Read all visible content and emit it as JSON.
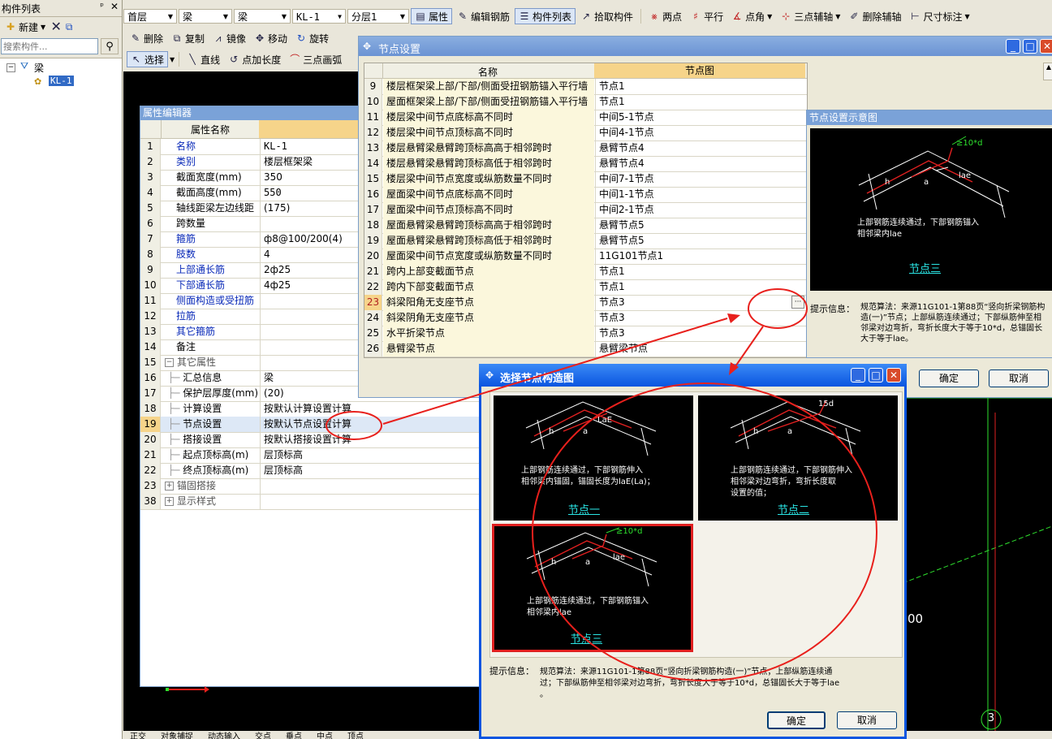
{
  "left_panel": {
    "title": "构件列表",
    "new_label": "新建",
    "search_placeholder": "搜索构件...",
    "tree_root": "梁",
    "tree_child": "KL-1"
  },
  "toolbar1": {
    "floor": "首层",
    "category": "梁",
    "type": "梁",
    "element": "KL-1",
    "layer": "分层1",
    "attr_label": "属性",
    "edit_rebar": "编辑钢筋",
    "component_list": "构件列表",
    "pick_component": "拾取构件",
    "two_points": "两点",
    "parallel": "平行",
    "point_angle": "点角",
    "three_point_axis": "三点辅轴",
    "delete_axis": "删除辅轴",
    "dimension": "尺寸标注"
  },
  "toolbar2": {
    "delete": "删除",
    "copy": "复制",
    "mirror": "镜像",
    "move": "移动",
    "rotate": "旋转"
  },
  "toolbar3": {
    "select": "选择",
    "line": "直线",
    "point_length": "点加长度",
    "three_point_arc": "三点画弧"
  },
  "property_editor": {
    "title": "属性编辑器",
    "col_name": "属性名称",
    "rows": [
      {
        "n": "1",
        "name": "名称",
        "value": "KL-1",
        "blue": true
      },
      {
        "n": "2",
        "name": "类别",
        "value": "楼层框架梁",
        "blue": true
      },
      {
        "n": "3",
        "name": "截面宽度(mm)",
        "value": "350",
        "blue": false
      },
      {
        "n": "4",
        "name": "截面高度(mm)",
        "value": "550",
        "blue": false
      },
      {
        "n": "5",
        "name": "轴线距梁左边线距",
        "value": "(175)",
        "blue": false
      },
      {
        "n": "6",
        "name": "跨数量",
        "value": "",
        "blue": false
      },
      {
        "n": "7",
        "name": "箍筋",
        "value": "ф8@100/200(4)",
        "blue": true
      },
      {
        "n": "8",
        "name": "肢数",
        "value": "4",
        "blue": true
      },
      {
        "n": "9",
        "name": "上部通长筋",
        "value": "2ф25",
        "blue": true
      },
      {
        "n": "10",
        "name": "下部通长筋",
        "value": "4ф25",
        "blue": true
      },
      {
        "n": "11",
        "name": "侧面构造或受扭筋",
        "value": "",
        "blue": true
      },
      {
        "n": "12",
        "name": "拉筋",
        "value": "",
        "blue": true
      },
      {
        "n": "13",
        "name": "其它箍筋",
        "value": "",
        "blue": true
      },
      {
        "n": "14",
        "name": "备注",
        "value": "",
        "blue": false
      },
      {
        "n": "15",
        "name": "其它属性",
        "value": "",
        "blue": false,
        "group": "-"
      },
      {
        "n": "16",
        "name": "汇总信息",
        "value": "梁",
        "blue": false,
        "child": true
      },
      {
        "n": "17",
        "name": "保护层厚度(mm)",
        "value": "(20)",
        "blue": false,
        "child": true
      },
      {
        "n": "18",
        "name": "计算设置",
        "value": "按默认计算设置计算",
        "blue": false,
        "child": true
      },
      {
        "n": "19",
        "name": "节点设置",
        "value": "按默认节点设置计算",
        "blue": false,
        "child": true,
        "selected": true
      },
      {
        "n": "20",
        "name": "搭接设置",
        "value": "按默认搭接设置计算",
        "blue": false,
        "child": true
      },
      {
        "n": "21",
        "name": "起点顶标高(m)",
        "value": "层顶标高",
        "blue": false,
        "child": true
      },
      {
        "n": "22",
        "name": "终点顶标高(m)",
        "value": "层顶标高",
        "blue": false,
        "child": true
      },
      {
        "n": "23",
        "name": "锚固搭接",
        "value": "",
        "blue": false,
        "group": "+"
      },
      {
        "n": "38",
        "name": "显示样式",
        "value": "",
        "blue": false,
        "group": "+"
      }
    ]
  },
  "node_settings": {
    "title": "节点设置",
    "col_name": "名称",
    "col_diagram": "节点图",
    "rows": [
      {
        "n": "9",
        "name": "楼层框架梁上部/下部/侧面受扭钢筋锚入平行墙",
        "value": "节点1"
      },
      {
        "n": "10",
        "name": "屋面框架梁上部/下部/侧面受扭钢筋锚入平行墙",
        "value": "节点1"
      },
      {
        "n": "11",
        "name": "楼层梁中间节点底标高不同时",
        "value": "中间5-1节点"
      },
      {
        "n": "12",
        "name": "楼层梁中间节点顶标高不同时",
        "value": "中间4-1节点"
      },
      {
        "n": "13",
        "name": "楼层悬臂梁悬臂跨顶标高高于相邻跨时",
        "value": "悬臂节点4"
      },
      {
        "n": "14",
        "name": "楼层悬臂梁悬臂跨顶标高低于相邻跨时",
        "value": "悬臂节点4"
      },
      {
        "n": "15",
        "name": "楼层梁中间节点宽度或纵筋数量不同时",
        "value": "中间7-1节点"
      },
      {
        "n": "16",
        "name": "屋面梁中间节点底标高不同时",
        "value": "中间1-1节点"
      },
      {
        "n": "17",
        "name": "屋面梁中间节点顶标高不同时",
        "value": "中间2-1节点"
      },
      {
        "n": "18",
        "name": "屋面悬臂梁悬臂跨顶标高高于相邻跨时",
        "value": "悬臂节点5"
      },
      {
        "n": "19",
        "name": "屋面悬臂梁悬臂跨顶标高低于相邻跨时",
        "value": "悬臂节点5"
      },
      {
        "n": "20",
        "name": "屋面梁中间节点宽度或纵筋数量不同时",
        "value": "11G101节点1"
      },
      {
        "n": "21",
        "name": "跨内上部变截面节点",
        "value": "节点1"
      },
      {
        "n": "22",
        "name": "跨内下部变截面节点",
        "value": "节点1"
      },
      {
        "n": "23",
        "name": "斜梁阳角无支座节点",
        "value": "节点3",
        "selected": true
      },
      {
        "n": "24",
        "name": "斜梁阴角无支座节点",
        "value": "节点3"
      },
      {
        "n": "25",
        "name": "水平折梁节点",
        "value": "节点3"
      },
      {
        "n": "26",
        "name": "悬臂梁节点",
        "value": "悬臂梁节点"
      }
    ],
    "ellipsis": "···"
  },
  "diagram_panel": {
    "title": "节点设置示意图",
    "caption1": "上部钢筋连续通过，下部钢筋锚入",
    "caption2": "相邻梁内lae",
    "node_label": "节点三",
    "hint_label": "提示信息：",
    "hint_text": "规范算法：来源11G101-1第88页“竖向折梁钢筋构造(一)”节点；上部纵筋连续通过；下部纵筋伸至相邻梁对边弯折，弯折长度大于等于10*d，总锚固长大于等于lae。",
    "ok": "确定",
    "cancel": "取消",
    "dim_text": "≥10*d",
    "lae": "lae",
    "a": "a",
    "h": "h"
  },
  "select_dialog": {
    "title": "选择节点构造图",
    "option1_caption1": "上部钢筋连续通过，下部钢筋伸入",
    "option1_caption2": "相邻梁内锚固，锚固长度为laE(La)；",
    "option1_label": "节点一",
    "option1_dim": "LaE",
    "option2_caption1": "上部钢筋连续通过，下部钢筋伸入",
    "option2_caption2": "相邻梁对边弯折，弯折长度取",
    "option2_caption3": "设置的值；",
    "option2_label": "节点二",
    "option2_dim": "15d",
    "option3_caption1": "上部钢筋连续通过，下部钢筋锚入",
    "option3_caption2": "相邻梁内lae",
    "option3_label": "节点三",
    "option3_dim": "≥10*d",
    "hint_label": "提示信息：",
    "hint_text1": "规范算法：来源11G101-1第88页“竖向折梁钢筋构造(一)”节点；上部纵筋连续通",
    "hint_text2": "过；下部纵筋伸至相邻梁对边弯折，弯折长度大于等于10*d，总锚固长大于等于lae",
    "hint_text3": "。",
    "ok": "确定",
    "cancel": "取消"
  },
  "canvas": {
    "axis_label": "3",
    "partial_text": "00"
  },
  "bottom_tabs": [
    "正交",
    "对象捕捉",
    "动态输入",
    "交点",
    "垂点",
    "中点",
    "顶点"
  ],
  "colors": {
    "annotation_red": "#e8201c",
    "cad_red": "#e02020",
    "cad_cyan": "#2ae4e4",
    "cad_green": "#2ee02e",
    "xp_blue": "#0a55e0"
  }
}
